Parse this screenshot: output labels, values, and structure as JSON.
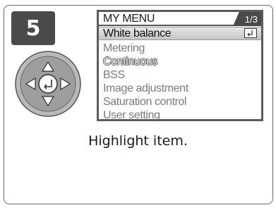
{
  "step": {
    "number": "5"
  },
  "screen": {
    "title": "MY MENU",
    "page_indicator": "1/3",
    "items": [
      {
        "label": "White balance",
        "state": "selected"
      },
      {
        "label": "Metering",
        "state": "dimmed"
      },
      {
        "label": "Continuous",
        "state": "outlined"
      },
      {
        "label": "BSS",
        "state": "dimmed"
      },
      {
        "label": "Image adjustment",
        "state": "dimmed"
      },
      {
        "label": "Saturation control",
        "state": "dimmed"
      },
      {
        "label": "User setting",
        "state": "dimmed"
      }
    ]
  },
  "caption": "Highlight item.",
  "icons": {
    "multi_selector": "multi-selector-dpad-icon",
    "enter": "enter-return-icon"
  },
  "colors": {
    "step_badge": "#4a4a4a",
    "screen_border": "#5c5c5c",
    "highlight": "#c4c4c4",
    "dimmed_text": "#7b7b7b"
  }
}
